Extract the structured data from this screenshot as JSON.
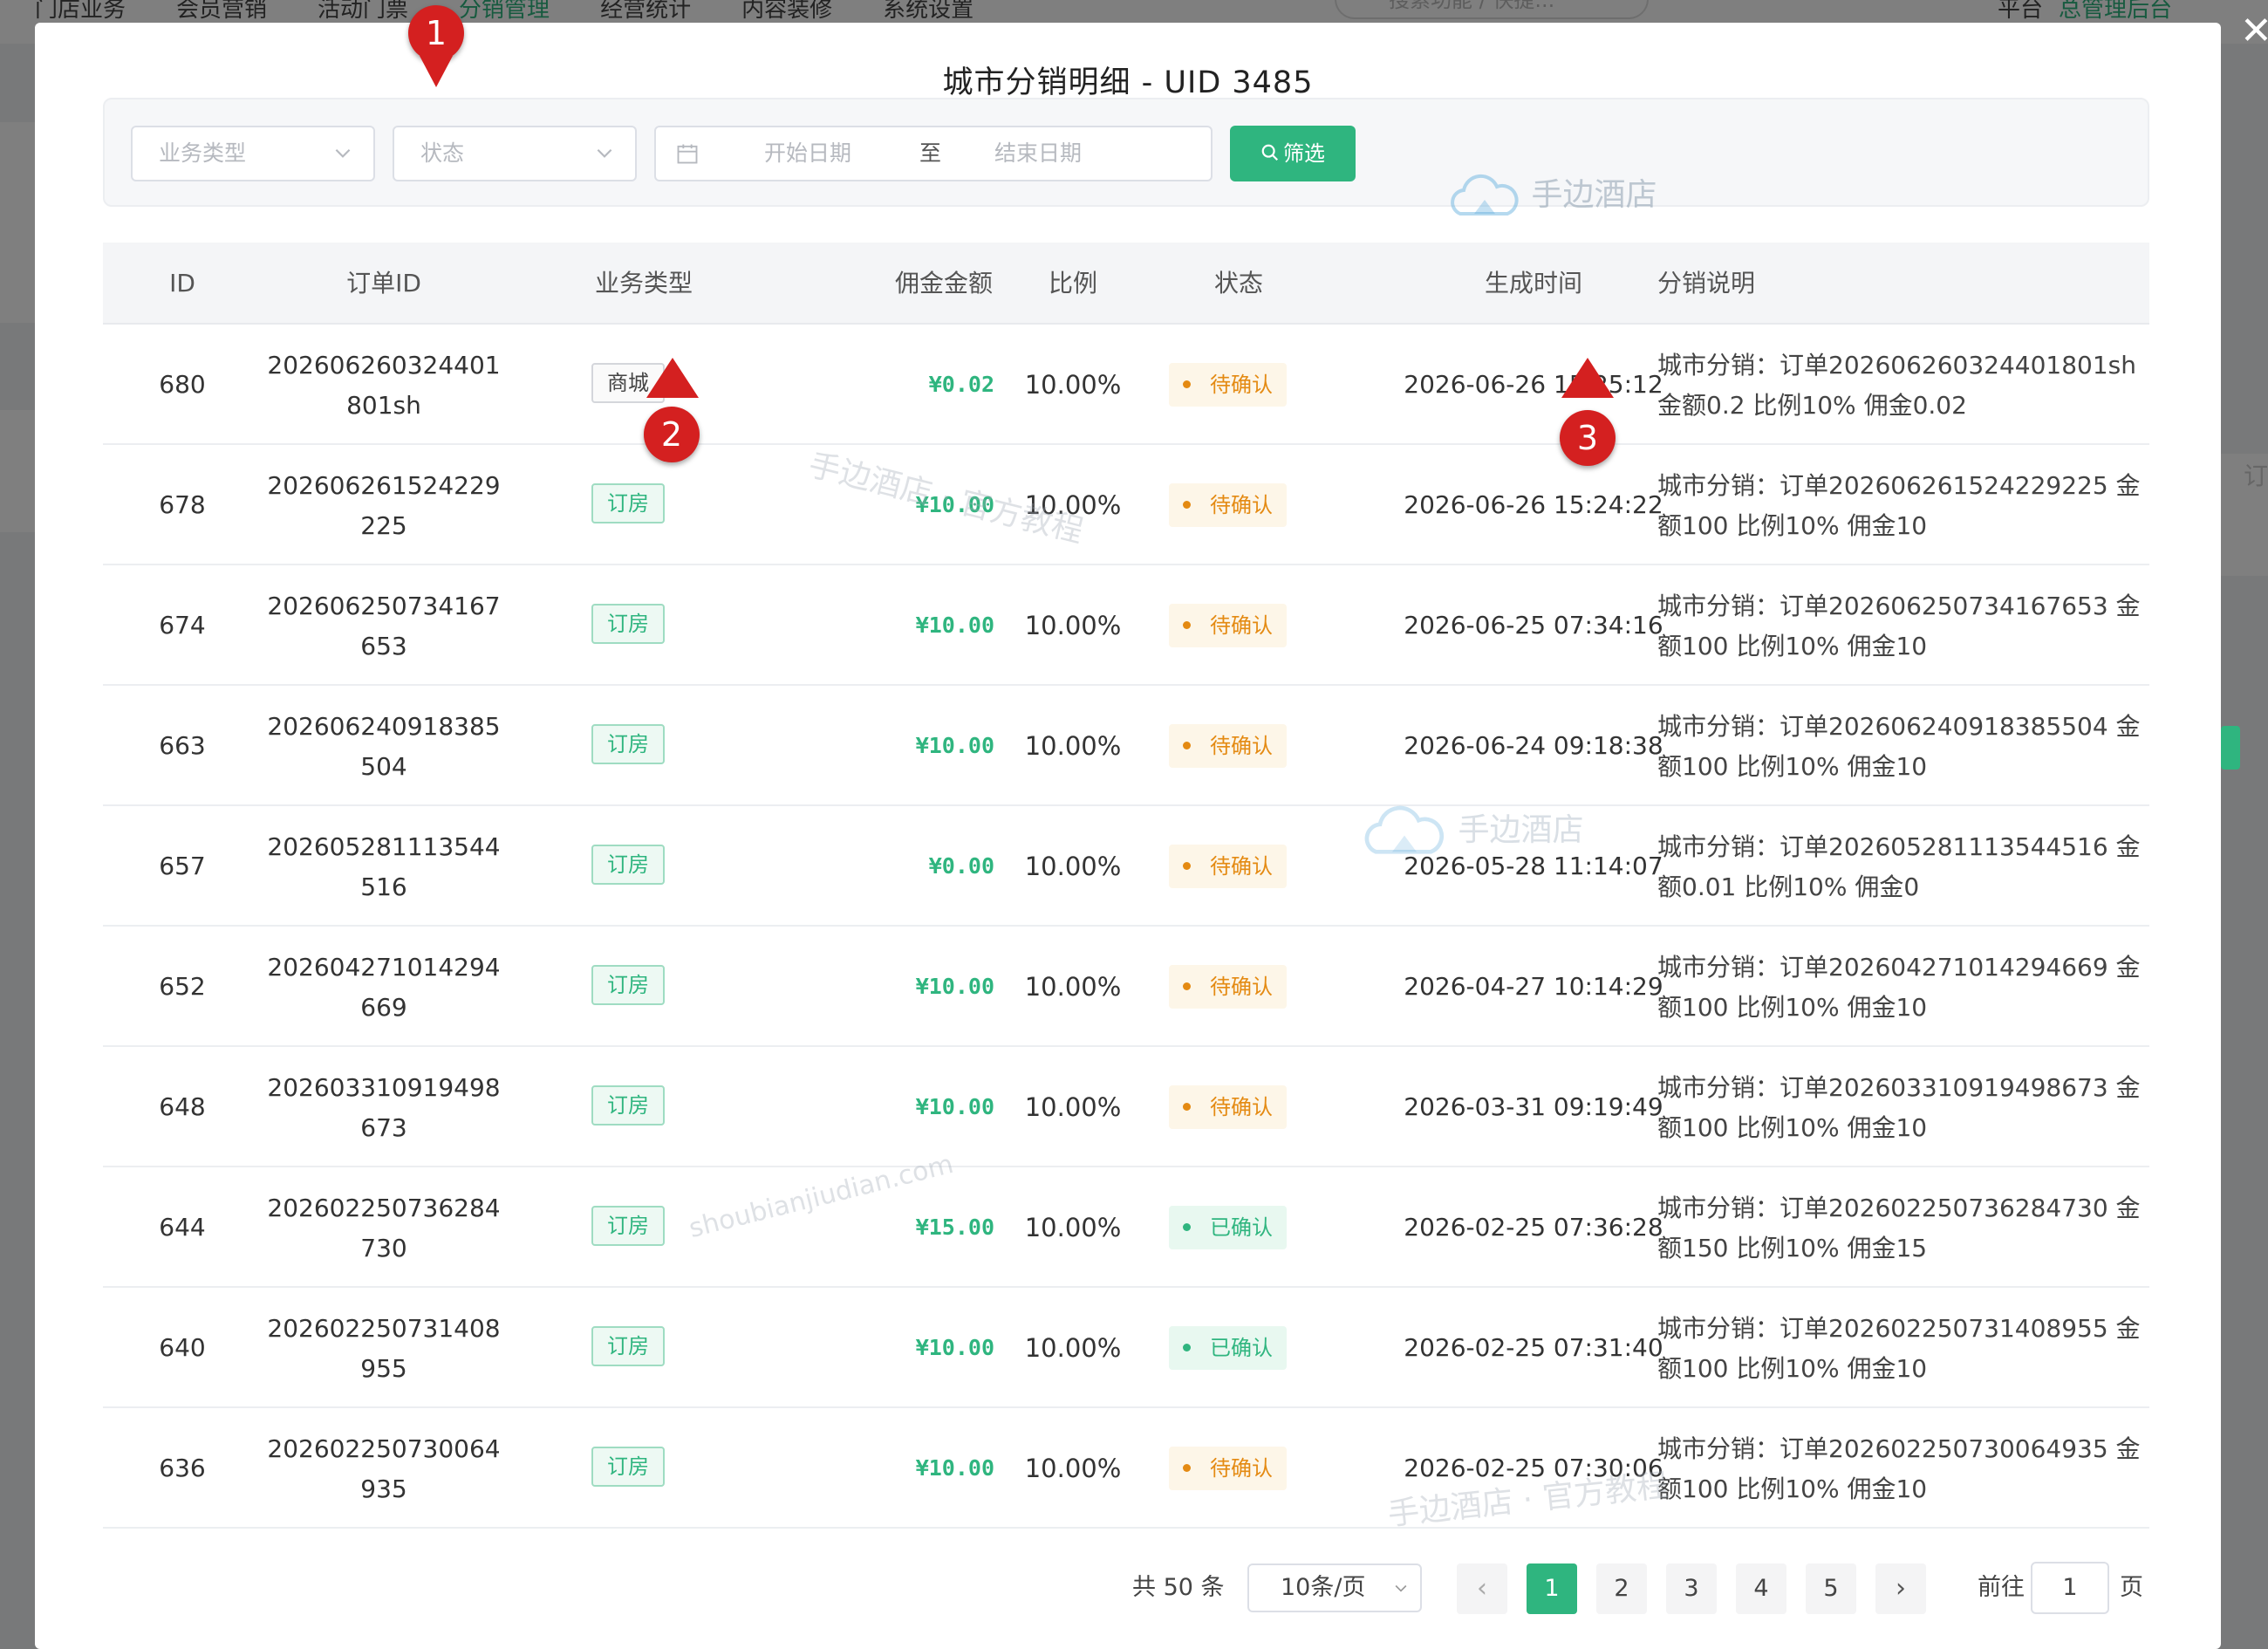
{
  "background": {
    "nav": [
      "门店业务",
      "会员营销",
      "活动门票",
      "分销管理",
      "经营统计",
      "内容装修",
      "系统设置"
    ],
    "active_nav": "分销管理",
    "search_placeholder": "搜索功能 / 快捷...",
    "right_links": [
      "平台",
      "总管理后台"
    ],
    "side_text": "订"
  },
  "modal": {
    "title": "城市分销明细 - UID 3485",
    "filters": {
      "business_type_placeholder": "业务类型",
      "status_placeholder": "状态",
      "start_date_placeholder": "开始日期",
      "date_separator": "至",
      "end_date_placeholder": "结束日期",
      "filter_button": "筛选"
    },
    "table": {
      "headers": [
        "ID",
        "订单ID",
        "业务类型",
        "佣金金额",
        "比例",
        "状态",
        "生成时间",
        "分销说明"
      ],
      "rows": [
        {
          "id": "680",
          "order_id": "202606260324401801sh",
          "type": "商城",
          "amount": "¥0.02",
          "ratio": "10.00%",
          "status": "待确认",
          "time": "2026-06-26 15:25:12",
          "desc": "城市分销：订单202606260324401801sh 金额0.2 比例10% 佣金0.02"
        },
        {
          "id": "678",
          "order_id": "202606261524229225",
          "type": "订房",
          "amount": "¥10.00",
          "ratio": "10.00%",
          "status": "待确认",
          "time": "2026-06-26 15:24:22",
          "desc": "城市分销：订单202606261524229225 金额100 比例10% 佣金10"
        },
        {
          "id": "674",
          "order_id": "202606250734167653",
          "type": "订房",
          "amount": "¥10.00",
          "ratio": "10.00%",
          "status": "待确认",
          "time": "2026-06-25 07:34:16",
          "desc": "城市分销：订单202606250734167653 金额100 比例10% 佣金10"
        },
        {
          "id": "663",
          "order_id": "202606240918385504",
          "type": "订房",
          "amount": "¥10.00",
          "ratio": "10.00%",
          "status": "待确认",
          "time": "2026-06-24 09:18:38",
          "desc": "城市分销：订单202606240918385504 金额100 比例10% 佣金10"
        },
        {
          "id": "657",
          "order_id": "202605281113544516",
          "type": "订房",
          "amount": "¥0.00",
          "ratio": "10.00%",
          "status": "待确认",
          "time": "2026-05-28 11:14:07",
          "desc": "城市分销：订单202605281113544516 金额0.01 比例10% 佣金0"
        },
        {
          "id": "652",
          "order_id": "202604271014294669",
          "type": "订房",
          "amount": "¥10.00",
          "ratio": "10.00%",
          "status": "待确认",
          "time": "2026-04-27 10:14:29",
          "desc": "城市分销：订单202604271014294669 金额100 比例10% 佣金10"
        },
        {
          "id": "648",
          "order_id": "202603310919498673",
          "type": "订房",
          "amount": "¥10.00",
          "ratio": "10.00%",
          "status": "待确认",
          "time": "2026-03-31 09:19:49",
          "desc": "城市分销：订单202603310919498673 金额100 比例10% 佣金10"
        },
        {
          "id": "644",
          "order_id": "202602250736284730",
          "type": "订房",
          "amount": "¥15.00",
          "ratio": "10.00%",
          "status": "已确认",
          "time": "2026-02-25 07:36:28",
          "desc": "城市分销：订单202602250736284730 金额150 比例10% 佣金15"
        },
        {
          "id": "640",
          "order_id": "202602250731408955",
          "type": "订房",
          "amount": "¥10.00",
          "ratio": "10.00%",
          "status": "已确认",
          "time": "2026-02-25 07:31:40",
          "desc": "城市分销：订单202602250731408955 金额100 比例10% 佣金10"
        },
        {
          "id": "636",
          "order_id": "202602250730064935",
          "type": "订房",
          "amount": "¥10.00",
          "ratio": "10.00%",
          "status": "待确认",
          "time": "2026-02-25 07:30:06",
          "desc": "城市分销：订单202602250730064935 金额100 比例10% 佣金10"
        }
      ]
    },
    "pagination": {
      "total": "共 50 条",
      "page_size": "10条/页",
      "pages": [
        "1",
        "2",
        "3",
        "4",
        "5"
      ],
      "current_page": "1",
      "goto_prefix": "前往",
      "goto_value": "1",
      "goto_suffix": "页"
    }
  },
  "watermarks": [
    "手边酒店",
    "手边酒店 · 官方教程",
    "shoubianjiudian.com"
  ],
  "markers": [
    "1",
    "2",
    "3"
  ],
  "colors": {
    "primary": "#2fb57f",
    "pending": "#e48a12",
    "marker": "#d42020"
  }
}
